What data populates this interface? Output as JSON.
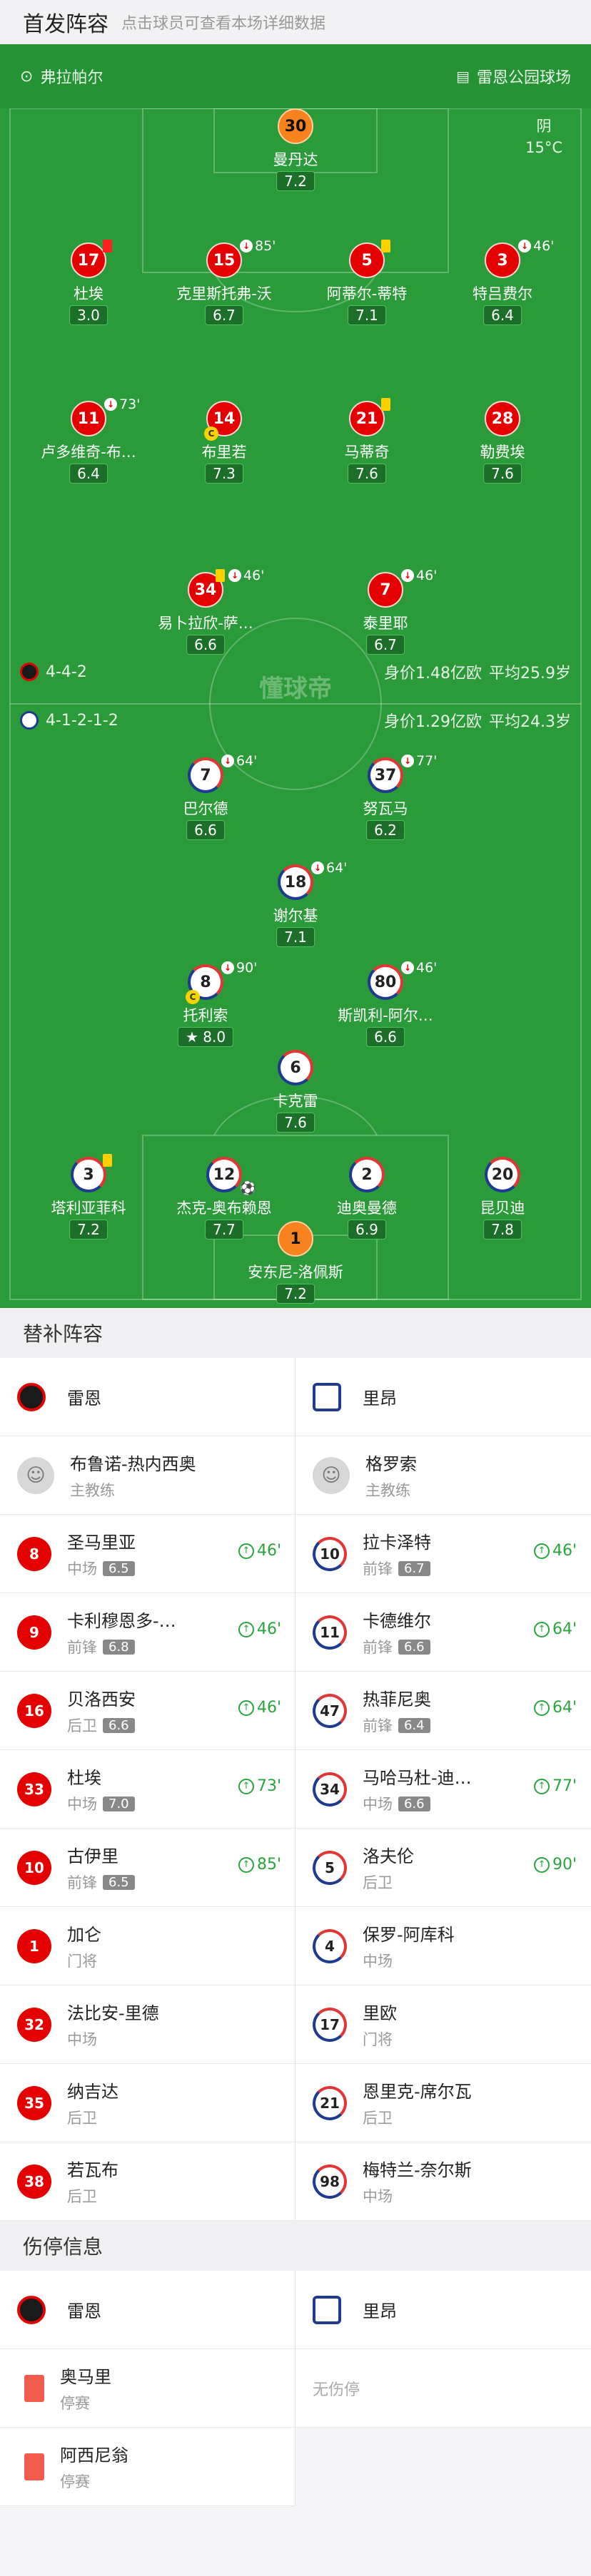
{
  "header": {
    "title": "首发阵容",
    "subtitle": "点击球员可查看本场详细数据"
  },
  "match": {
    "referee": "弗拉帕尔",
    "stadium": "雷恩公园球场",
    "weather": "阴",
    "temp": "15°C"
  },
  "home": {
    "name": "雷恩",
    "formation": "4-4-2",
    "value": "身价1.48亿欧",
    "age": "平均25.9岁",
    "color": "#e40000"
  },
  "away": {
    "name": "里昂",
    "formation": "4-1-2-1-2",
    "value": "身价1.29亿欧",
    "age": "平均24.3岁",
    "color": "#1e3b8e"
  },
  "watermark": "懂球帝",
  "home_players": [
    {
      "no": "30",
      "name": "曼丹达",
      "rating": "7.2",
      "gk": true
    },
    {
      "no": "17",
      "name": "杜埃",
      "rating": "3.0",
      "card": "red"
    },
    {
      "no": "15",
      "name": "克里斯托弗-沃",
      "rating": "6.7",
      "sub": "85'"
    },
    {
      "no": "5",
      "name": "阿蒂尔-蒂特",
      "rating": "7.1",
      "card": "yellow"
    },
    {
      "no": "3",
      "name": "特吕费尔",
      "rating": "6.4",
      "sub": "46'"
    },
    {
      "no": "11",
      "name": "卢多维奇-布…",
      "rating": "6.4",
      "sub": "73'"
    },
    {
      "no": "14",
      "name": "布里若",
      "rating": "7.3",
      "captain": "C"
    },
    {
      "no": "21",
      "name": "马蒂奇",
      "rating": "7.6",
      "card": "yellow"
    },
    {
      "no": "28",
      "name": "勒费埃",
      "rating": "7.6"
    },
    {
      "no": "34",
      "name": "易卜拉欣-萨…",
      "rating": "6.6",
      "sub": "46'",
      "card": "yellow"
    },
    {
      "no": "7",
      "name": "泰里耶",
      "rating": "6.7",
      "sub": "46'"
    }
  ],
  "away_players": [
    {
      "no": "7",
      "name": "巴尔德",
      "rating": "6.6",
      "sub": "64'"
    },
    {
      "no": "37",
      "name": "努瓦马",
      "rating": "6.2",
      "sub": "77'"
    },
    {
      "no": "18",
      "name": "谢尔基",
      "rating": "7.1",
      "sub": "64'"
    },
    {
      "no": "8",
      "name": "托利索",
      "rating": "8.0",
      "sub": "90'",
      "captain": "C",
      "best": true
    },
    {
      "no": "80",
      "name": "斯凯利-阿尔…",
      "rating": "6.6",
      "sub": "46'"
    },
    {
      "no": "6",
      "name": "卡克雷",
      "rating": "7.6"
    },
    {
      "no": "3",
      "name": "塔利亚菲科",
      "rating": "7.2",
      "card": "yellow"
    },
    {
      "no": "12",
      "name": "杰克-奥布赖恩",
      "rating": "7.7",
      "goal": "⚽"
    },
    {
      "no": "2",
      "name": "迪奥曼德",
      "rating": "6.9"
    },
    {
      "no": "20",
      "name": "昆贝迪",
      "rating": "7.8"
    },
    {
      "no": "1",
      "name": "安东尼-洛佩斯",
      "rating": "7.2",
      "gk": true
    }
  ],
  "subs_title": "替补阵容",
  "coach_label": "主教练",
  "home_coach": "布鲁诺-热内西奥",
  "away_coach": "格罗索",
  "home_subs": [
    {
      "no": "8",
      "name": "圣马里亚",
      "pos": "中场",
      "rating": "6.5",
      "in": "46'"
    },
    {
      "no": "9",
      "name": "卡利穆恩多-…",
      "pos": "前锋",
      "rating": "6.8",
      "in": "46'"
    },
    {
      "no": "16",
      "name": "贝洛西安",
      "pos": "后卫",
      "rating": "6.6",
      "in": "46'"
    },
    {
      "no": "33",
      "name": "杜埃",
      "pos": "中场",
      "rating": "7.0",
      "in": "73'"
    },
    {
      "no": "10",
      "name": "古伊里",
      "pos": "前锋",
      "rating": "6.5",
      "in": "85'"
    },
    {
      "no": "1",
      "name": "加仑",
      "pos": "门将",
      "rating": "",
      "in": ""
    },
    {
      "no": "32",
      "name": "法比安-里德",
      "pos": "中场",
      "rating": "",
      "in": ""
    },
    {
      "no": "35",
      "name": "纳吉达",
      "pos": "后卫",
      "rating": "",
      "in": ""
    },
    {
      "no": "38",
      "name": "若瓦布",
      "pos": "后卫",
      "rating": "",
      "in": ""
    }
  ],
  "away_subs": [
    {
      "no": "10",
      "name": "拉卡泽特",
      "pos": "前锋",
      "rating": "6.7",
      "in": "46'"
    },
    {
      "no": "11",
      "name": "卡德维尔",
      "pos": "前锋",
      "rating": "6.6",
      "in": "64'"
    },
    {
      "no": "47",
      "name": "热菲尼奥",
      "pos": "前锋",
      "rating": "6.4",
      "in": "64'"
    },
    {
      "no": "34",
      "name": "马哈马杜-迪…",
      "pos": "中场",
      "rating": "6.6",
      "in": "77'"
    },
    {
      "no": "5",
      "name": "洛夫伦",
      "pos": "后卫",
      "rating": "",
      "in": "90'"
    },
    {
      "no": "4",
      "name": "保罗-阿库科",
      "pos": "中场",
      "rating": "",
      "in": ""
    },
    {
      "no": "17",
      "name": "里欧",
      "pos": "门将",
      "rating": "",
      "in": ""
    },
    {
      "no": "21",
      "name": "恩里克-席尔瓦",
      "pos": "后卫",
      "rating": "",
      "in": ""
    },
    {
      "no": "98",
      "name": "梅特兰-奈尔斯",
      "pos": "中场",
      "rating": "",
      "in": ""
    }
  ],
  "injury_title": "伤停信息",
  "home_injuries": [
    {
      "name": "奥马里",
      "status": "停赛"
    },
    {
      "name": "阿西尼翁",
      "status": "停赛"
    }
  ],
  "away_injuries_text": "无伤停"
}
